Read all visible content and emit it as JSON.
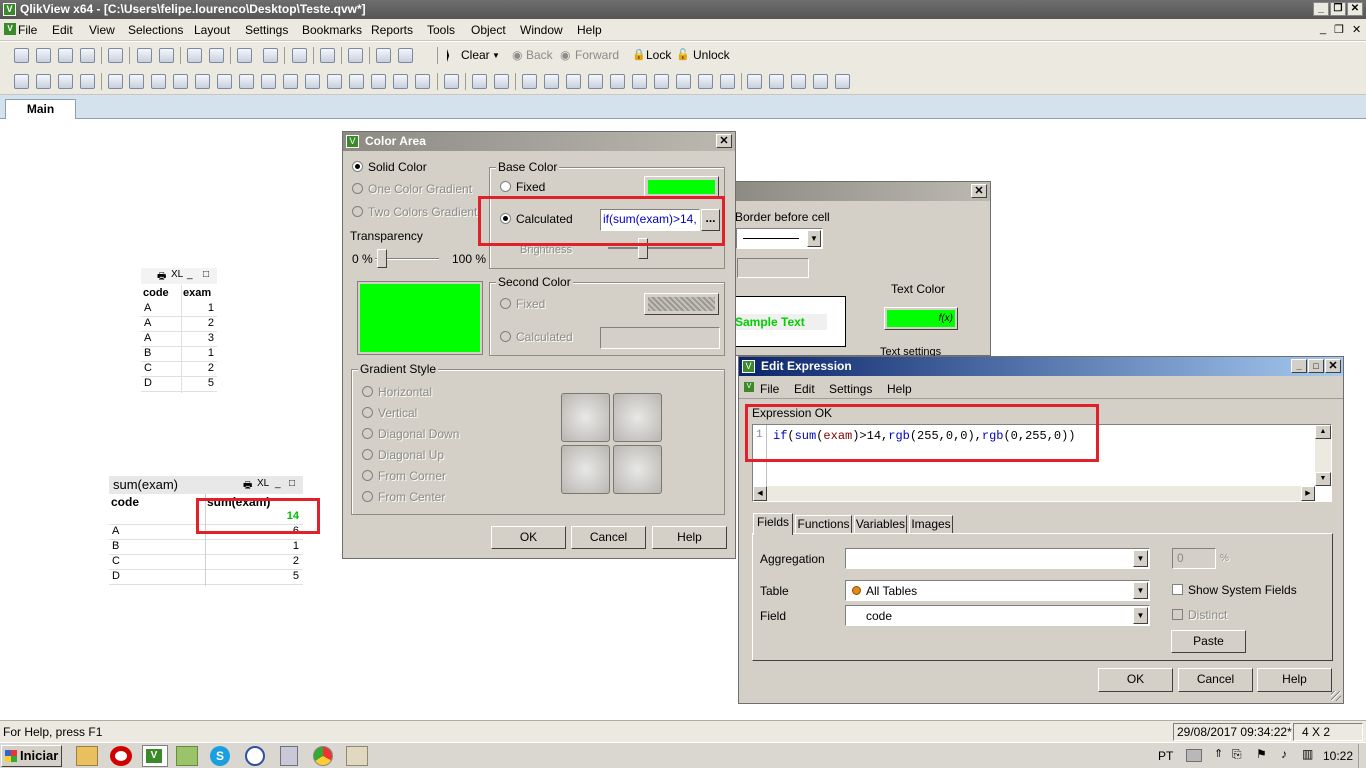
{
  "window": {
    "title": "QlikView x64 - [C:\\Users\\felipe.lourenco\\Desktop\\Teste.qvw*]",
    "app_icon": "V"
  },
  "menu": [
    "File",
    "Edit",
    "View",
    "Selections",
    "Layout",
    "Settings",
    "Bookmarks",
    "Reports",
    "Tools",
    "Object",
    "Window",
    "Help"
  ],
  "toolbar": {
    "clear": "Clear",
    "back": "Back",
    "forward": "Forward",
    "lock": "Lock",
    "unlock": "Unlock"
  },
  "tabs": [
    "Main"
  ],
  "listbox1": {
    "col1": "code",
    "col2": "exam",
    "title_icons": "XL",
    "rows": [
      [
        "A",
        "1"
      ],
      [
        "A",
        "2"
      ],
      [
        "A",
        "3"
      ],
      [
        "B",
        "1"
      ],
      [
        "C",
        "2"
      ],
      [
        "D",
        "5"
      ]
    ]
  },
  "chart": {
    "title": "sum(exam)",
    "title_icons": "XL",
    "col1": "code",
    "col2": "sum(exam)",
    "total": "14",
    "rows": [
      [
        "A",
        "6"
      ],
      [
        "B",
        "1"
      ],
      [
        "C",
        "2"
      ],
      [
        "D",
        "5"
      ]
    ]
  },
  "color_area": {
    "title": "Color Area",
    "solid": "Solid Color",
    "one_grad": "One Color Gradient",
    "two_grad": "Two Colors Gradient",
    "transparency": "Transparency",
    "t_min": "0 %",
    "t_max": "100 %",
    "base_color": "Base Color",
    "fixed": "Fixed",
    "calculated": "Calculated",
    "expr_preview": "if(sum(exam)>14,",
    "brightness": "Brightness",
    "ellipsis": "...",
    "second_color": "Second Color",
    "fixed2": "Fixed",
    "calculated2": "Calculated",
    "gradient_style": "Gradient Style",
    "styles": [
      "Horizontal",
      "Vertical",
      "Diagonal Down",
      "Diagonal Up",
      "From Corner",
      "From Center"
    ],
    "ok": "OK",
    "cancel": "Cancel",
    "help": "Help",
    "green": "#00ff00"
  },
  "bg_dialog": {
    "border_before": "Border before cell",
    "text_color": "Text Color",
    "sample": "Sample Text",
    "fx": "f(x)",
    "text_settings": "Text settings"
  },
  "edit_expr": {
    "title": "Edit Expression",
    "menu": [
      "File",
      "Edit",
      "Settings",
      "Help"
    ],
    "status": "Expression OK",
    "line_no": "1",
    "expr": {
      "p1": "if",
      "p2": "(",
      "p3": "sum",
      "p4": "(",
      "p5": "exam",
      "p6": ")>14,",
      "p7": "rgb",
      "p8": "(255,0,0),",
      "p9": "rgb",
      "p10": "(0,255,0))"
    },
    "tabs": [
      "Fields",
      "Functions",
      "Variables",
      "Images"
    ],
    "aggregation": "Aggregation",
    "table": "Table",
    "table_val": "All Tables",
    "field": "Field",
    "field_val": "code",
    "pct_val": "0",
    "pct": "%",
    "show_system": "Show System Fields",
    "distinct": "Distinct",
    "paste": "Paste",
    "ok": "OK",
    "cancel": "Cancel",
    "help": "Help"
  },
  "status": {
    "help": "For Help, press F1",
    "datetime": "29/08/2017 09:34:22*",
    "dims": "4 X 2"
  },
  "taskbar": {
    "start": "Iniciar",
    "lang": "PT",
    "time": "10:22"
  }
}
